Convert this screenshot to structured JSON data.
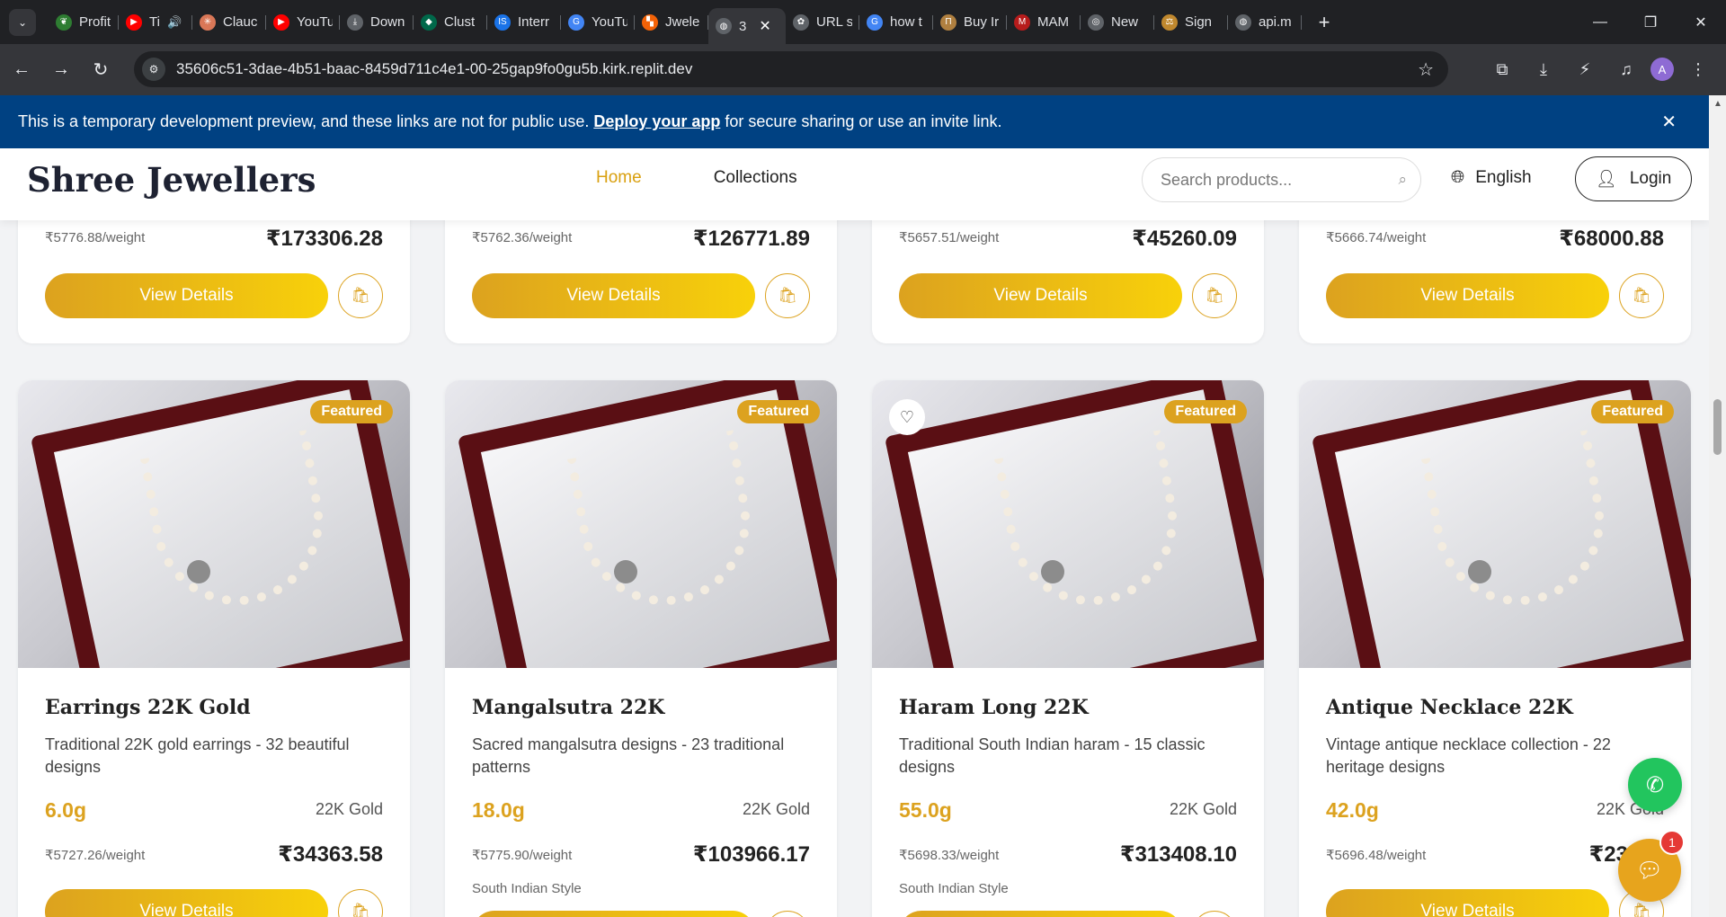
{
  "browser": {
    "tabs": [
      {
        "label": "Profit",
        "icon": "plant-icon",
        "color": "#2e7d32"
      },
      {
        "label": "Ti",
        "icon": "youtube-icon",
        "color": "#ff0000",
        "audio": "🔊"
      },
      {
        "label": "Clauc",
        "icon": "claude-icon",
        "color": "#d97757"
      },
      {
        "label": "YouTu",
        "icon": "youtube-icon",
        "color": "#ff0000"
      },
      {
        "label": "Down",
        "icon": "download-icon",
        "color": "#5f6368"
      },
      {
        "label": "Clust",
        "icon": "mongodb-icon",
        "color": "#00684a"
      },
      {
        "label": "Interr",
        "icon": "interview-icon",
        "color": "#1a73e8"
      },
      {
        "label": "YouTu",
        "icon": "google-icon",
        "color": "#4285f4"
      },
      {
        "label": "Jwele",
        "icon": "replit-icon",
        "color": "#f26207"
      },
      {
        "label": "3",
        "icon": "globe-icon",
        "color": "#5f6368",
        "active": true
      },
      {
        "label": "URL s",
        "icon": "openai-icon",
        "color": "#5f6368"
      },
      {
        "label": "how t",
        "icon": "google-icon",
        "color": "#4285f4"
      },
      {
        "label": "Buy Ir",
        "icon": "bank-icon",
        "color": "#b08040"
      },
      {
        "label": "MAM",
        "icon": "mam-icon",
        "color": "#b71c1c"
      },
      {
        "label": "New",
        "icon": "chrome-icon",
        "color": "#5f6368"
      },
      {
        "label": "Sign",
        "icon": "scale-icon",
        "color": "#c0882e"
      },
      {
        "label": "api.m",
        "icon": "globe-icon",
        "color": "#5f6368"
      }
    ],
    "url": "35606c51-3dae-4b51-baac-8459d711c4e1-00-25gap9fo0gu5b.kirk.replit.dev",
    "profile_initial": "A"
  },
  "banner": {
    "text_before": "This is a temporary development preview, and these links are not for public use.",
    "link": "Deploy your app",
    "text_after": "for secure sharing or use an invite link."
  },
  "header": {
    "brand": "Shree Jewellers",
    "nav": [
      "Home",
      "Collections"
    ],
    "search_placeholder": "Search products...",
    "language": "English",
    "login": "Login"
  },
  "top_cards": [
    {
      "rate": "₹5776.88/weight",
      "price": "₹173306.28",
      "button": "View Details"
    },
    {
      "rate": "₹5762.36/weight",
      "price": "₹126771.89",
      "button": "View Details"
    },
    {
      "rate": "₹5657.51/weight",
      "price": "₹45260.09",
      "button": "View Details"
    },
    {
      "rate": "₹5666.74/weight",
      "price": "₹68000.88",
      "button": "View Details"
    }
  ],
  "products": [
    {
      "badge": "Featured",
      "title": "Earrings 22K Gold",
      "description": "Traditional 22K gold earrings - 32 beautiful designs",
      "weight": "6.0g",
      "purity": "22K Gold",
      "rate": "₹5727.26/weight",
      "price": "₹34363.58",
      "style": "",
      "button": "View Details"
    },
    {
      "badge": "Featured",
      "title": "Mangalsutra 22K",
      "description": "Sacred mangalsutra designs - 23 traditional patterns",
      "weight": "18.0g",
      "purity": "22K Gold",
      "rate": "₹5775.90/weight",
      "price": "₹103966.17",
      "style": "South Indian Style",
      "button": "View Details"
    },
    {
      "badge": "Featured",
      "title": "Haram Long 22K",
      "description": "Traditional South Indian haram - 15 classic designs",
      "weight": "55.0g",
      "purity": "22K Gold",
      "rate": "₹5698.33/weight",
      "price": "₹313408.10",
      "style": "South Indian Style",
      "button": "View Details"
    },
    {
      "badge": "Featured",
      "title": "Antique Necklace 22K",
      "description": "Vintage antique necklace collection - 22 heritage designs",
      "weight": "42.0g",
      "purity": "22K Gold",
      "rate": "₹5696.48/weight",
      "price": "₹23925",
      "style": "",
      "button": "View Details"
    }
  ],
  "chat": {
    "notification_count": "1"
  },
  "colors": {
    "accent": "#dca21f",
    "banner": "#004182",
    "phone": "#22c55e"
  }
}
